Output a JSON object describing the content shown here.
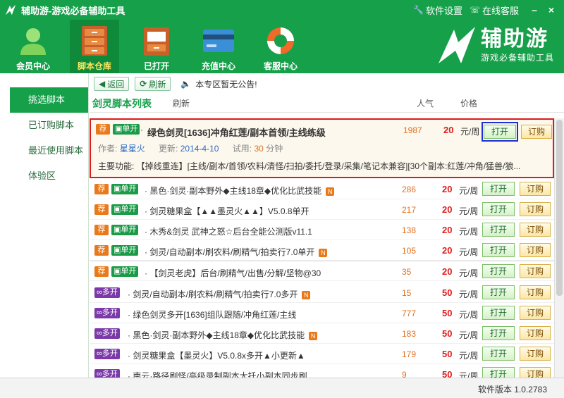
{
  "window": {
    "title": "辅助游-游戏必备辅助工具",
    "links": [
      "软件设置",
      "在线客服"
    ],
    "controls": [
      "–",
      "×"
    ]
  },
  "nav": [
    {
      "label": "会员中心",
      "icon": "member-icon"
    },
    {
      "label": "脚本仓库",
      "icon": "cabinet-icon",
      "active": true
    },
    {
      "label": "已打开",
      "icon": "folder-icon"
    },
    {
      "label": "充值中心",
      "icon": "card-icon"
    },
    {
      "label": "客服中心",
      "icon": "lifebuoy-icon"
    }
  ],
  "brand": {
    "name": "辅助游",
    "slogan": "游戏必备辅助工具"
  },
  "sidebar": [
    "挑选脚本",
    "已订购脚本",
    "最近使用脚本",
    "体验区"
  ],
  "subbar": {
    "back": "返回",
    "refresh": "刷新",
    "notice": "本专区暂无公告!"
  },
  "list": {
    "title": "剑灵脚本列表",
    "refresh": "刷新",
    "col_pop": "人气",
    "col_price": "价格"
  },
  "featured": {
    "tag_rec": "荐",
    "tag_mode": "单开",
    "title": "绿色剑灵[1636]冲角红莲/副本首领/主线练级",
    "pop": "1987",
    "price": "20",
    "unit": "元/周",
    "open": "打开",
    "subscribe": "订购",
    "author_label": "作者:",
    "author": "星星火",
    "date_label": "更新:",
    "date": "2014-4-10",
    "trial_label": "试用:",
    "trial": "30",
    "trial_unit": "分钟",
    "func": "主要功能: 【掉线重连】[主线/副本/首领/农料/清怪/扫拍/委托/登录/采集/笔记本兼容][30个副本:红莲/冲角/猛兽/狼..."
  },
  "rows": [
    {
      "rec": "荐",
      "mode": "单开",
      "title": "黑色·剑灵·副本野外◆主线18章◆优化比武技能",
      "new": true,
      "pop": "286",
      "price": "20",
      "unit": "元/周",
      "open": "打开",
      "subscribe": "订购"
    },
    {
      "rec": "荐",
      "mode": "单开",
      "title": "剑灵糖果盒【▲▲墨灵火▲▲】V5.0.8单开",
      "new": false,
      "pop": "217",
      "price": "20",
      "unit": "元/周",
      "open": "打开",
      "subscribe": "订购"
    },
    {
      "rec": "荐",
      "mode": "单开",
      "title": "木秀&剑灵 武神之怒☆后台全能公测版v11.1",
      "new": false,
      "pop": "138",
      "price": "20",
      "unit": "元/周",
      "open": "打开",
      "subscribe": "订购"
    },
    {
      "rec": "荐",
      "mode": "单开",
      "title": "剑灵/自动副本/刷农料/刷精气/拍卖行7.0单开",
      "new": true,
      "pop": "105",
      "price": "20",
      "unit": "元/周",
      "open": "打开",
      "subscribe": "订购"
    },
    {
      "rec": "荐",
      "mode": "单开",
      "title": "【剑灵老虎】后台/刷精气/出售/分解/坚物@30",
      "new": false,
      "pop": "35",
      "price": "20",
      "unit": "元/周",
      "open": "打开",
      "subscribe": "订购"
    },
    {
      "rec": "",
      "mode": "多开",
      "title": "剑灵/自动副本/刷农料/刷精气/拍卖行7.0多开",
      "new": true,
      "pop": "15",
      "price": "50",
      "unit": "元/周",
      "open": "打开",
      "subscribe": "订购"
    },
    {
      "rec": "",
      "mode": "多开",
      "title": "绿色剑灵多开[1636]组队跟随/冲角红莲/主线",
      "new": false,
      "pop": "777",
      "price": "50",
      "unit": "元/周",
      "open": "打开",
      "subscribe": "订购"
    },
    {
      "rec": "",
      "mode": "多开",
      "title": "黑色·剑灵·副本野外◆主线18章◆优化比武技能",
      "new": true,
      "pop": "183",
      "price": "50",
      "unit": "元/周",
      "open": "打开",
      "subscribe": "订购"
    },
    {
      "rec": "",
      "mode": "多开",
      "title": "剑灵糖果盒【墨灵火】V5.0.8x多开▲小更新▲",
      "new": false,
      "pop": "179",
      "price": "50",
      "unit": "元/周",
      "open": "打开",
      "subscribe": "订购"
    },
    {
      "rec": "",
      "mode": "多开",
      "title": "南云·路径刷怪/高级录制副本大托小副本同步刷",
      "new": false,
      "pop": "9",
      "price": "50",
      "unit": "元/周",
      "open": "打开",
      "subscribe": "订购"
    }
  ],
  "status": {
    "version": "软件版本 1.0.2783"
  },
  "colors": {
    "brand_green": "#16a04a",
    "highlight_red": "#e01b1b",
    "focus_blue": "#1f2fd6"
  }
}
